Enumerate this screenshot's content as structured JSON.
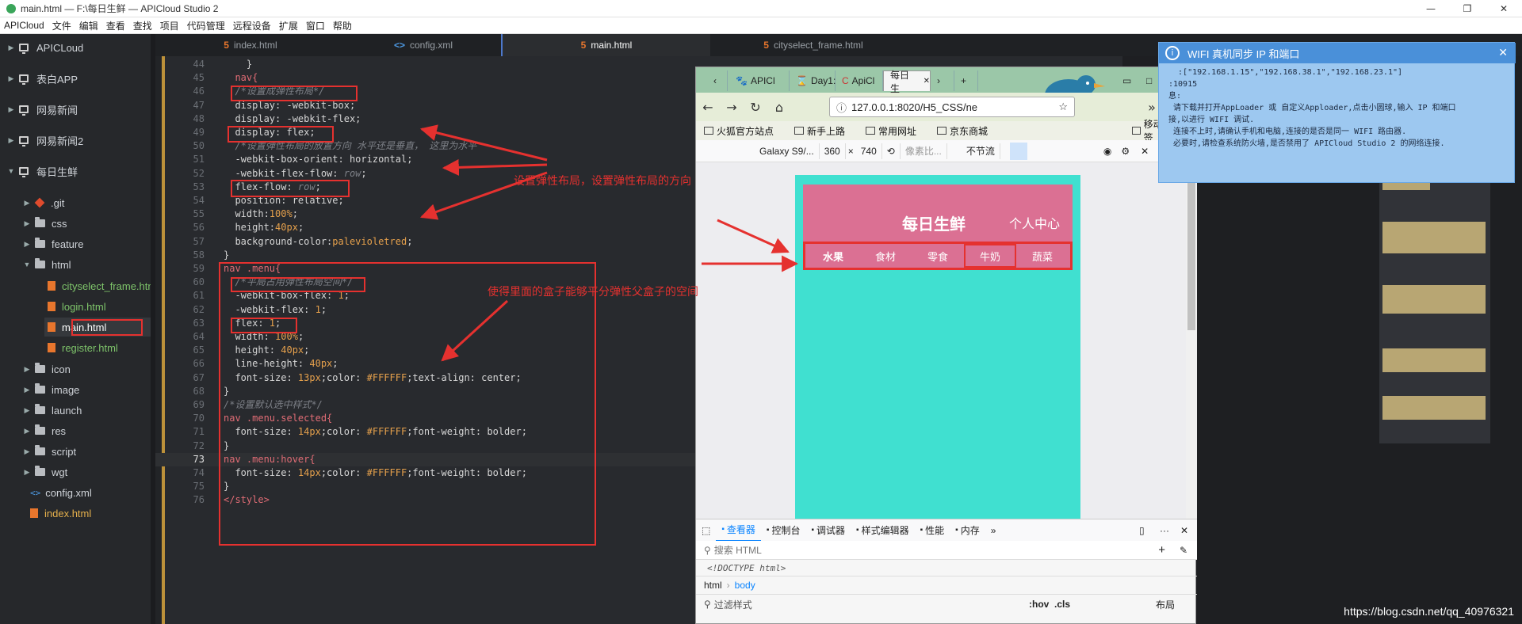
{
  "window": {
    "title": "main.html — F:\\每日生鲜 — APICloud Studio 2",
    "btn_min": "—",
    "btn_max": "❐",
    "btn_close": "✕"
  },
  "menubar": [
    "APICloud",
    "文件",
    "编辑",
    "查看",
    "查找",
    "项目",
    "代码管理",
    "远程设备",
    "扩展",
    "窗口",
    "帮助"
  ],
  "sidebar": {
    "arrow_collapsed": "▶",
    "arrow_expanded": "▼",
    "items": [
      {
        "label": "APICLoud",
        "type": "project",
        "expanded": false
      },
      {
        "label": "表白APP",
        "type": "project",
        "expanded": false
      },
      {
        "label": "网易新闻",
        "type": "project",
        "expanded": false
      },
      {
        "label": "网易新闻2",
        "type": "project",
        "expanded": false
      },
      {
        "label": "每日生鲜",
        "type": "project",
        "expanded": true
      },
      {
        "label": ".git",
        "type": "git-folder",
        "expanded": false
      },
      {
        "label": "css",
        "type": "folder",
        "expanded": false
      },
      {
        "label": "feature",
        "type": "folder",
        "expanded": false
      },
      {
        "label": "html",
        "type": "folder",
        "expanded": true
      },
      {
        "label": "cityselect_frame.html",
        "type": "html-file"
      },
      {
        "label": "login.html",
        "type": "html-file"
      },
      {
        "label": "main.html",
        "type": "html-file",
        "selected": true
      },
      {
        "label": "register.html",
        "type": "html-file"
      },
      {
        "label": "icon",
        "type": "folder",
        "expanded": false
      },
      {
        "label": "image",
        "type": "folder",
        "expanded": false
      },
      {
        "label": "launch",
        "type": "folder",
        "expanded": false
      },
      {
        "label": "res",
        "type": "folder",
        "expanded": false
      },
      {
        "label": "script",
        "type": "folder",
        "expanded": false
      },
      {
        "label": "wgt",
        "type": "folder",
        "expanded": false
      },
      {
        "label": "config.xml",
        "type": "xml-file"
      },
      {
        "label": "index.html",
        "type": "html-file"
      }
    ]
  },
  "tabs": [
    {
      "label": "index.html",
      "icon": "html5-icon",
      "icon_text": "5"
    },
    {
      "label": "config.xml",
      "icon": "xml-icon",
      "icon_text": "<>"
    },
    {
      "label": "main.html",
      "icon": "html5-icon",
      "icon_text": "5",
      "active": true
    },
    {
      "label": "cityselect_frame.html",
      "icon": "html5-icon",
      "icon_text": "5"
    }
  ],
  "editor": {
    "current_line": 73,
    "lines": [
      {
        "n": "44",
        "t": "    }"
      },
      {
        "n": "45",
        "t": "  nav{"
      },
      {
        "n": "46",
        "t": "  /*设置成弹性布局*/"
      },
      {
        "n": "47",
        "t": "  display: -webkit-box;"
      },
      {
        "n": "48",
        "t": "  display: -webkit-flex;"
      },
      {
        "n": "49",
        "t": "  display: flex;"
      },
      {
        "n": "50",
        "t": "  /*设置弹性布局的放置方向 水平还是垂直， 这里为水平"
      },
      {
        "n": "51",
        "t": "  -webkit-box-orient: horizontal;"
      },
      {
        "n": "52",
        "t": "  -webkit-flex-flow: row;"
      },
      {
        "n": "53",
        "t": "  flex-flow: row;"
      },
      {
        "n": "54",
        "t": "  position: relative;"
      },
      {
        "n": "55",
        "t": "  width:100%;"
      },
      {
        "n": "56",
        "t": "  height:40px;"
      },
      {
        "n": "57",
        "t": "  background-color:palevioletred;"
      },
      {
        "n": "58",
        "t": "}"
      },
      {
        "n": "59",
        "t": "nav .menu{"
      },
      {
        "n": "60",
        "t": "  /*平局占用弹性布局空间*/"
      },
      {
        "n": "61",
        "t": "  -webkit-box-flex: 1;"
      },
      {
        "n": "62",
        "t": "  -webkit-flex: 1;"
      },
      {
        "n": "63",
        "t": "  flex: 1;"
      },
      {
        "n": "64",
        "t": "  width: 100%;"
      },
      {
        "n": "65",
        "t": "  height: 40px;"
      },
      {
        "n": "66",
        "t": "  line-height: 40px;"
      },
      {
        "n": "67",
        "t": "  font-size: 13px;color: #FFFFFF;text-align: center;"
      },
      {
        "n": "68",
        "t": "}"
      },
      {
        "n": "69",
        "t": "/*设置默认选中样式*/"
      },
      {
        "n": "70",
        "t": "nav .menu.selected{"
      },
      {
        "n": "71",
        "t": "  font-size: 14px;color: #FFFFFF;font-weight: bolder;"
      },
      {
        "n": "72",
        "t": "}"
      },
      {
        "n": "73",
        "t": "nav .menu:hover{"
      },
      {
        "n": "74",
        "t": "  font-size: 14px;color: #FFFFFF;font-weight: bolder;"
      },
      {
        "n": "75",
        "t": "}"
      },
      {
        "n": "76",
        "t": "</style>"
      }
    ]
  },
  "annotations": {
    "flex_layout": "设置弹性布局，设置弹性布局的方向",
    "flex_share": "使得里面的盒子能够平分弹性父盒子的空间"
  },
  "browser": {
    "tabs": [
      "APICl",
      "Day1:",
      "ApiCl",
      "每日生",
      "›",
      "+"
    ],
    "tab_icons": {
      "APICl": "🐾",
      "Day1:": "⌛",
      "ApiCl": "C",
      "每日生": "",
      "›": "",
      "+": ""
    },
    "tab_close": "✕",
    "nav": {
      "back": "←",
      "forward": "→",
      "reload": "↻",
      "home": "⌂",
      "more": "»",
      "menu": "≡",
      "win_min": "▭",
      "win_max": "□"
    },
    "url": "127.0.0.1:8020/H5_CSS/ne",
    "url_lock": "ⓘ",
    "url_bookmark": "☆",
    "bookmarks": [
      "火狐官方站点",
      "新手上路",
      "常用网址",
      "京东商城",
      "移动版书签"
    ],
    "rdm": {
      "device": "Galaxy S9/...",
      "width": "360",
      "times": "×",
      "height": "740",
      "dpr": "像素比...",
      "throttle": "不节流"
    },
    "rdm_icons": {
      "rotate": "⟲",
      "screenshot": "◉",
      "settings": "⚙",
      "close": "✕"
    },
    "page": {
      "title": "每日生鲜",
      "user_center": "个人中心",
      "menus": [
        "水果",
        "食材",
        "零食",
        "牛奶",
        "蔬菜"
      ]
    },
    "devtools": {
      "picker": "⬚",
      "tabs": [
        "查看器",
        "控制台",
        "调试器",
        "样式编辑器",
        "性能",
        "内存",
        "»"
      ],
      "side_icons": [
        "▯",
        "···",
        "✕"
      ],
      "search_placeholder": "搜索 HTML",
      "search_icon": "⚲",
      "add_icon": "+",
      "eyedropper_icon": "✎",
      "doctype": "<!DOCTYPE html>",
      "breadcrumb": [
        "html",
        "body"
      ],
      "breadcrumb_sep": "›",
      "filter": "过滤样式",
      "filter_icon": "⚲",
      "hov": ":hov",
      "cls": ".cls",
      "layout": "布局"
    }
  },
  "notification": {
    "title": "WIFI 真机同步 IP 和端口",
    "info_icon": "i",
    "close": "✕",
    "lines": [
      "  :[\"192.168.1.15\",\"192.168.38.1\",\"192.168.23.1\"]",
      ":10915",
      "息:",
      " 请下载并打开AppLoader 或 自定义Apploader,点击小圆球,输入 IP 和端口",
      "接,以进行 WIFI 调试.",
      " 连接不上时,请确认手机和电脑,连接的是否是同一 WIFI 路由器.",
      " 必要时,请检查系统防火墙,是否禁用了 APICloud Studio 2 的网络连接."
    ]
  },
  "watermark": "https://blog.csdn.net/qq_40976321",
  "colors": {
    "accent": "#e5312f",
    "turquoise": "#40e0d0",
    "palevioletred": "#db7093"
  }
}
